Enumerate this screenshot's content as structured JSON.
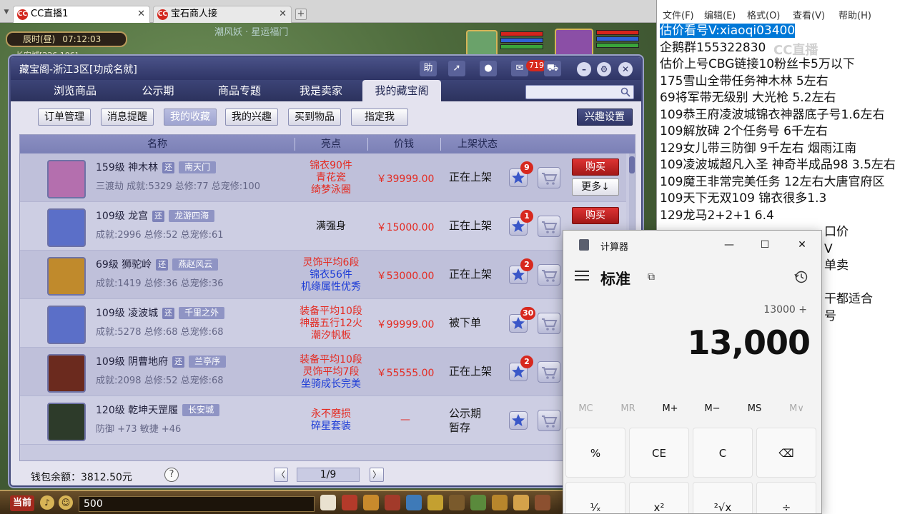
{
  "browser": {
    "tabs": [
      {
        "label": "CC直播1",
        "favicon": "cc-logo-icon"
      },
      {
        "label": "宝石商人接",
        "favicon": "cc-logo-icon"
      }
    ],
    "favicon_text": "CC",
    "close_glyph": "✕",
    "new_tab_glyph": "+"
  },
  "game": {
    "time_label": "辰时(昼)",
    "time_value": "07:12:03",
    "location": "长安城[226,106]",
    "banner": "潮风妖 · 星运福门",
    "bottom": {
      "now_label": "当前",
      "chat_value": "500"
    }
  },
  "cbg": {
    "title": "藏宝阁-浙江3区[功成名就]",
    "toolbar": {
      "help_label": "助",
      "message_badge": "719"
    },
    "nav_tabs": [
      "浏览商品",
      "公示期",
      "商品专题",
      "我是卖家",
      "我的藏宝阁"
    ],
    "active_nav": 4,
    "sub_buttons": [
      "订单管理",
      "消息提醒",
      "我的收藏",
      "我的兴趣",
      "买到物品",
      "指定我"
    ],
    "active_sub": 2,
    "interest_settings": "兴趣设置",
    "columns": [
      "名称",
      "亮点",
      "价钱",
      "上架状态"
    ],
    "rows": [
      {
        "level_name": "159级  神木林",
        "server_tag": "还",
        "loc_tag": "南天门",
        "stats": "三渡劫 成就:5329 总修:77 总宠修:100",
        "highlights": [
          {
            "text": "锦衣90件",
            "color": "r"
          },
          {
            "text": "青花瓷",
            "color": "r"
          },
          {
            "text": "绮梦泳圈",
            "color": "r"
          }
        ],
        "price": "￥39999.00",
        "status": "正在上架",
        "fav_count": "9",
        "buy": "购买",
        "more": "更多↓",
        "avatar_color": "#b46fae"
      },
      {
        "level_name": "109级  龙宫",
        "server_tag": "还",
        "loc_tag": "龙游四海",
        "stats": "成就:2996 总修:52 总宠修:61",
        "highlights": [
          {
            "text": "满强身",
            "color": "k"
          }
        ],
        "price": "￥15000.00",
        "status": "正在上架",
        "fav_count": "1",
        "buy": "购买",
        "avatar_color": "#5b6fc8"
      },
      {
        "level_name": "69级  狮驼岭",
        "server_tag": "还",
        "loc_tag": "燕赵风云",
        "stats": "成就:1419 总修:36 总宠修:36",
        "highlights": [
          {
            "text": "灵饰平均6段",
            "color": "r"
          },
          {
            "text": "锦衣56件",
            "color": "b"
          },
          {
            "text": "机缘属性优秀",
            "color": "b"
          }
        ],
        "price": "￥53000.00",
        "status": "正在上架",
        "fav_count": "2",
        "avatar_color": "#c08a2c"
      },
      {
        "level_name": "109级  凌波城",
        "server_tag": "还",
        "loc_tag": "千里之外",
        "stats": "成就:5278 总修:68 总宠修:68",
        "highlights": [
          {
            "text": "装备平均10段",
            "color": "r"
          },
          {
            "text": "神器五行12火",
            "color": "r"
          },
          {
            "text": "潮汐帆板",
            "color": "r"
          }
        ],
        "price": "￥99999.00",
        "status": "被下单",
        "fav_count": "30",
        "avatar_color": "#5b6fc8"
      },
      {
        "level_name": "109级  阴曹地府",
        "server_tag": "还",
        "loc_tag": "兰亭序",
        "stats": "成就:2098 总修:52 总宠修:68",
        "highlights": [
          {
            "text": "装备平均10段",
            "color": "r"
          },
          {
            "text": "灵饰平均7段",
            "color": "r"
          },
          {
            "text": "坐骑成长完美",
            "color": "b"
          }
        ],
        "price": "￥55555.00",
        "status": "正在上架",
        "fav_count": "2",
        "avatar_color": "#6b2a1e"
      },
      {
        "level_name": "120级  乾坤天罡履",
        "loc_tag": "长安城",
        "stats": "防御 +73  敏捷 +46",
        "highlights": [
          {
            "text": "永不磨损",
            "color": "r"
          },
          {
            "text": "碎星套装",
            "color": "b"
          }
        ],
        "price": "—",
        "status": "公示期",
        "status2": "暂存",
        "avatar_color": "#2d3b2a"
      }
    ],
    "footer": {
      "wallet": "钱包余额：3812.50元",
      "help": "?",
      "page": "1/9",
      "prev": "〈",
      "next": "〉"
    }
  },
  "notepad": {
    "menu": [
      "文件(F)",
      "编辑(E)",
      "格式(O)",
      "查看(V)",
      "帮助(H)"
    ],
    "watermark": "CC直播",
    "lines": [
      "估价看号V:xiaoqi03400",
      "企鹅群155322830",
      "估价上号CBG链接10粉丝卡5万以下",
      "175雪山全带任务神木林 5左右",
      "69将军带无级别 大光枪 5.2左右",
      "109恭王府凌波城锦衣神器底子号1.6左右",
      "109解放碑 2个任务号 6千左右",
      "129女儿带三防御 9千左右 烟雨江南",
      "109凌波城超凡入圣 神奇半成品98 3.5左右",
      "109魔王非常完美任务 12左右大唐官府区",
      "109天下无双109  锦衣很多1.3",
      "129龙马2+2+1  6.4"
    ],
    "partial_lines": [
      "口价",
      "V",
      "单卖",
      "",
      "干都适合",
      "号"
    ]
  },
  "calculator": {
    "title": "计算器",
    "mode": "标准",
    "keep_on_top_glyph": "⧉",
    "expression": "13000 +",
    "result": "13,000",
    "window_buttons": [
      "—",
      "☐",
      "✕"
    ],
    "memory_buttons": [
      "MC",
      "MR",
      "M+",
      "M−",
      "MS",
      "M∨"
    ],
    "keys_row1": [
      "%",
      "CE",
      "C",
      "⌫"
    ],
    "keys_row2": [
      "¹⁄ₓ",
      "x²",
      "²√x",
      "÷"
    ]
  },
  "colors": {
    "cbg_header": "#2f3566",
    "price_red": "#e42b22",
    "highlight_blue": "#1d3cd7",
    "buy_red": "#b31c1c",
    "notepad_selection": "#0078d7"
  }
}
